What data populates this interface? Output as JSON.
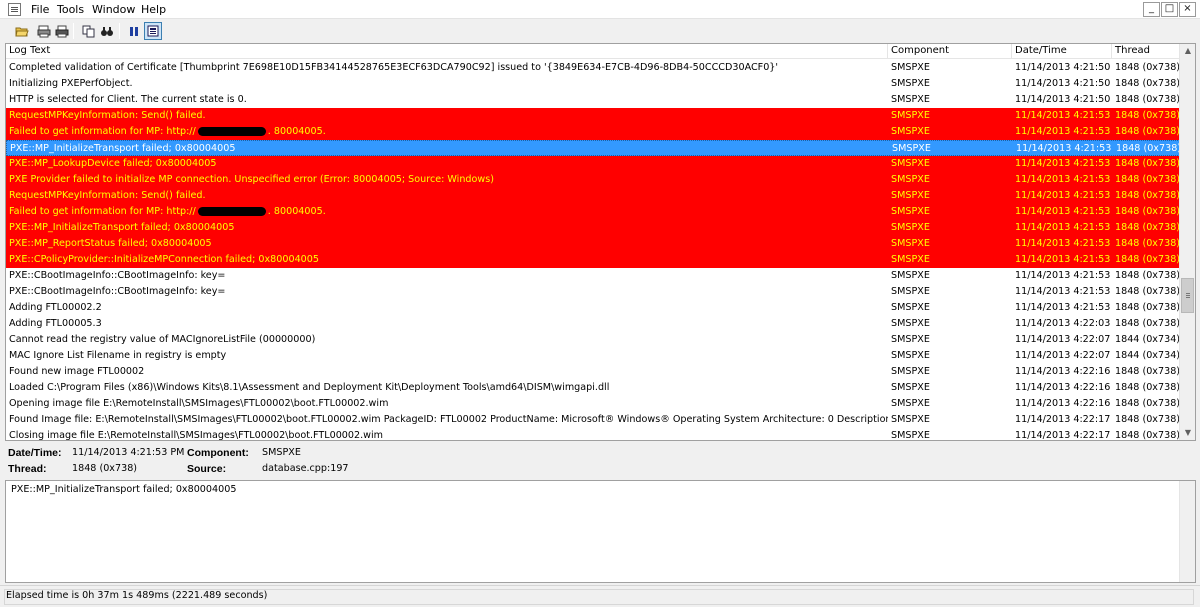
{
  "menu": {
    "items": [
      "File",
      "Tools",
      "Window",
      "Help"
    ],
    "window_buttons": [
      "_",
      "□",
      "×"
    ]
  },
  "toolbar": {
    "icons": [
      "open-icon",
      "print-setup-icon",
      "print-icon",
      "copy-icon",
      "find-icon",
      "pause-icon",
      "stop-icon"
    ]
  },
  "log": {
    "headers": [
      "Log Text",
      "Component",
      "Date/Time",
      "Thread"
    ],
    "rows": [
      {
        "text": "Completed validation of Certificate [Thumbprint 7E698E10D15FB34144528765E3ECF63DCA790C92] issued to '{3849E634-E7CB-4D96-8DB4-50CCCD30ACF0}'",
        "component": "SMSPXE",
        "datetime": "11/14/2013 4:21:50 PM",
        "thread": "1848 (0x738)",
        "state": "normal"
      },
      {
        "text": "Initializing PXEPerfObject.",
        "component": "SMSPXE",
        "datetime": "11/14/2013 4:21:50 PM",
        "thread": "1848 (0x738)",
        "state": "normal"
      },
      {
        "text": "HTTP is selected for Client. The current state is 0.",
        "component": "SMSPXE",
        "datetime": "11/14/2013 4:21:50 PM",
        "thread": "1848 (0x738)",
        "state": "normal"
      },
      {
        "text": "RequestMPKeyInformation: Send() failed.",
        "component": "SMSPXE",
        "datetime": "11/14/2013 4:21:53 PM",
        "thread": "1848 (0x738)",
        "state": "error"
      },
      {
        "text": "Failed to get information for MP: http://",
        "text_suffix": ". 80004005.",
        "redacted": true,
        "component": "SMSPXE",
        "datetime": "11/14/2013 4:21:53 PM",
        "thread": "1848 (0x738)",
        "state": "error"
      },
      {
        "text": "PXE::MP_InitializeTransport failed; 0x80004005",
        "component": "SMSPXE",
        "datetime": "11/14/2013 4:21:53 PM",
        "thread": "1848 (0x738)",
        "state": "selected"
      },
      {
        "text": "PXE::MP_LookupDevice failed; 0x80004005",
        "component": "SMSPXE",
        "datetime": "11/14/2013 4:21:53 PM",
        "thread": "1848 (0x738)",
        "state": "error"
      },
      {
        "text": "PXE Provider failed to initialize MP connection.  Unspecified error (Error: 80004005; Source: Windows)",
        "component": "SMSPXE",
        "datetime": "11/14/2013 4:21:53 PM",
        "thread": "1848 (0x738)",
        "state": "error"
      },
      {
        "text": "RequestMPKeyInformation: Send() failed.",
        "component": "SMSPXE",
        "datetime": "11/14/2013 4:21:53 PM",
        "thread": "1848 (0x738)",
        "state": "error"
      },
      {
        "text": "Failed to get information for MP: http://",
        "text_suffix": ". 80004005.",
        "redacted": true,
        "component": "SMSPXE",
        "datetime": "11/14/2013 4:21:53 PM",
        "thread": "1848 (0x738)",
        "state": "error"
      },
      {
        "text": "PXE::MP_InitializeTransport failed; 0x80004005",
        "component": "SMSPXE",
        "datetime": "11/14/2013 4:21:53 PM",
        "thread": "1848 (0x738)",
        "state": "error"
      },
      {
        "text": "PXE::MP_ReportStatus failed; 0x80004005",
        "component": "SMSPXE",
        "datetime": "11/14/2013 4:21:53 PM",
        "thread": "1848 (0x738)",
        "state": "error"
      },
      {
        "text": "PXE::CPolicyProvider::InitializeMPConnection failed; 0x80004005",
        "component": "SMSPXE",
        "datetime": "11/14/2013 4:21:53 PM",
        "thread": "1848 (0x738)",
        "state": "error"
      },
      {
        "text": "PXE::CBootImageInfo::CBootImageInfo: key=",
        "component": "SMSPXE",
        "datetime": "11/14/2013 4:21:53 PM",
        "thread": "1848 (0x738)",
        "state": "normal"
      },
      {
        "text": "PXE::CBootImageInfo::CBootImageInfo: key=",
        "component": "SMSPXE",
        "datetime": "11/14/2013 4:21:53 PM",
        "thread": "1848 (0x738)",
        "state": "normal"
      },
      {
        "text": "Adding FTL00002.2",
        "component": "SMSPXE",
        "datetime": "11/14/2013 4:21:53 PM",
        "thread": "1848 (0x738)",
        "state": "normal"
      },
      {
        "text": "Adding FTL00005.3",
        "component": "SMSPXE",
        "datetime": "11/14/2013 4:22:03 PM",
        "thread": "1848 (0x738)",
        "state": "normal"
      },
      {
        "text": "Cannot read the registry value of MACIgnoreListFile (00000000)",
        "component": "SMSPXE",
        "datetime": "11/14/2013 4:22:07 PM",
        "thread": "1844 (0x734)",
        "state": "normal"
      },
      {
        "text": "MAC Ignore List Filename in registry is empty",
        "component": "SMSPXE",
        "datetime": "11/14/2013 4:22:07 PM",
        "thread": "1844 (0x734)",
        "state": "normal"
      },
      {
        "text": "Found new image FTL00002",
        "component": "SMSPXE",
        "datetime": "11/14/2013 4:22:16 PM",
        "thread": "1848 (0x738)",
        "state": "normal"
      },
      {
        "text": "Loaded C:\\Program Files (x86)\\Windows Kits\\8.1\\Assessment and Deployment Kit\\Deployment Tools\\amd64\\DISM\\wimgapi.dll",
        "component": "SMSPXE",
        "datetime": "11/14/2013 4:22:16 PM",
        "thread": "1848 (0x738)",
        "state": "normal"
      },
      {
        "text": "Opening image file E:\\RemoteInstall\\SMSImages\\FTL00002\\boot.FTL00002.wim",
        "component": "SMSPXE",
        "datetime": "11/14/2013 4:22:16 PM",
        "thread": "1848 (0x738)",
        "state": "normal"
      },
      {
        "text": "Found Image file: E:\\RemoteInstall\\SMSImages\\FTL00002\\boot.FTL00002.wim PackageID: FTL00002 ProductName: Microsoft® Windows® Operating System Architecture: 0 Description: Microsoft ...",
        "component": "SMSPXE",
        "datetime": "11/14/2013 4:22:17 PM",
        "thread": "1848 (0x738)",
        "state": "normal"
      },
      {
        "text": "Closing image file E:\\RemoteInstall\\SMSImages\\FTL00002\\boot.FTL00002.wim",
        "component": "SMSPXE",
        "datetime": "11/14/2013 4:22:17 PM",
        "thread": "1848 (0x738)",
        "state": "normal"
      }
    ]
  },
  "details": {
    "datetime_label": "Date/Time:",
    "datetime_value": "11/14/2013 4:21:53 PM",
    "component_label": "Component:",
    "component_value": "SMSPXE",
    "thread_label": "Thread:",
    "thread_value": "1848 (0x738)",
    "source_label": "Source:",
    "source_value": "database.cpp:197",
    "message": "PXE::MP_InitializeTransport failed; 0x80004005"
  },
  "status": {
    "text": "Elapsed time is 0h 37m 1s 489ms (2221.489 seconds)"
  },
  "colors": {
    "error_bg": "#ff0000",
    "error_fg": "#ffff00",
    "selected_bg": "#3399ff"
  }
}
